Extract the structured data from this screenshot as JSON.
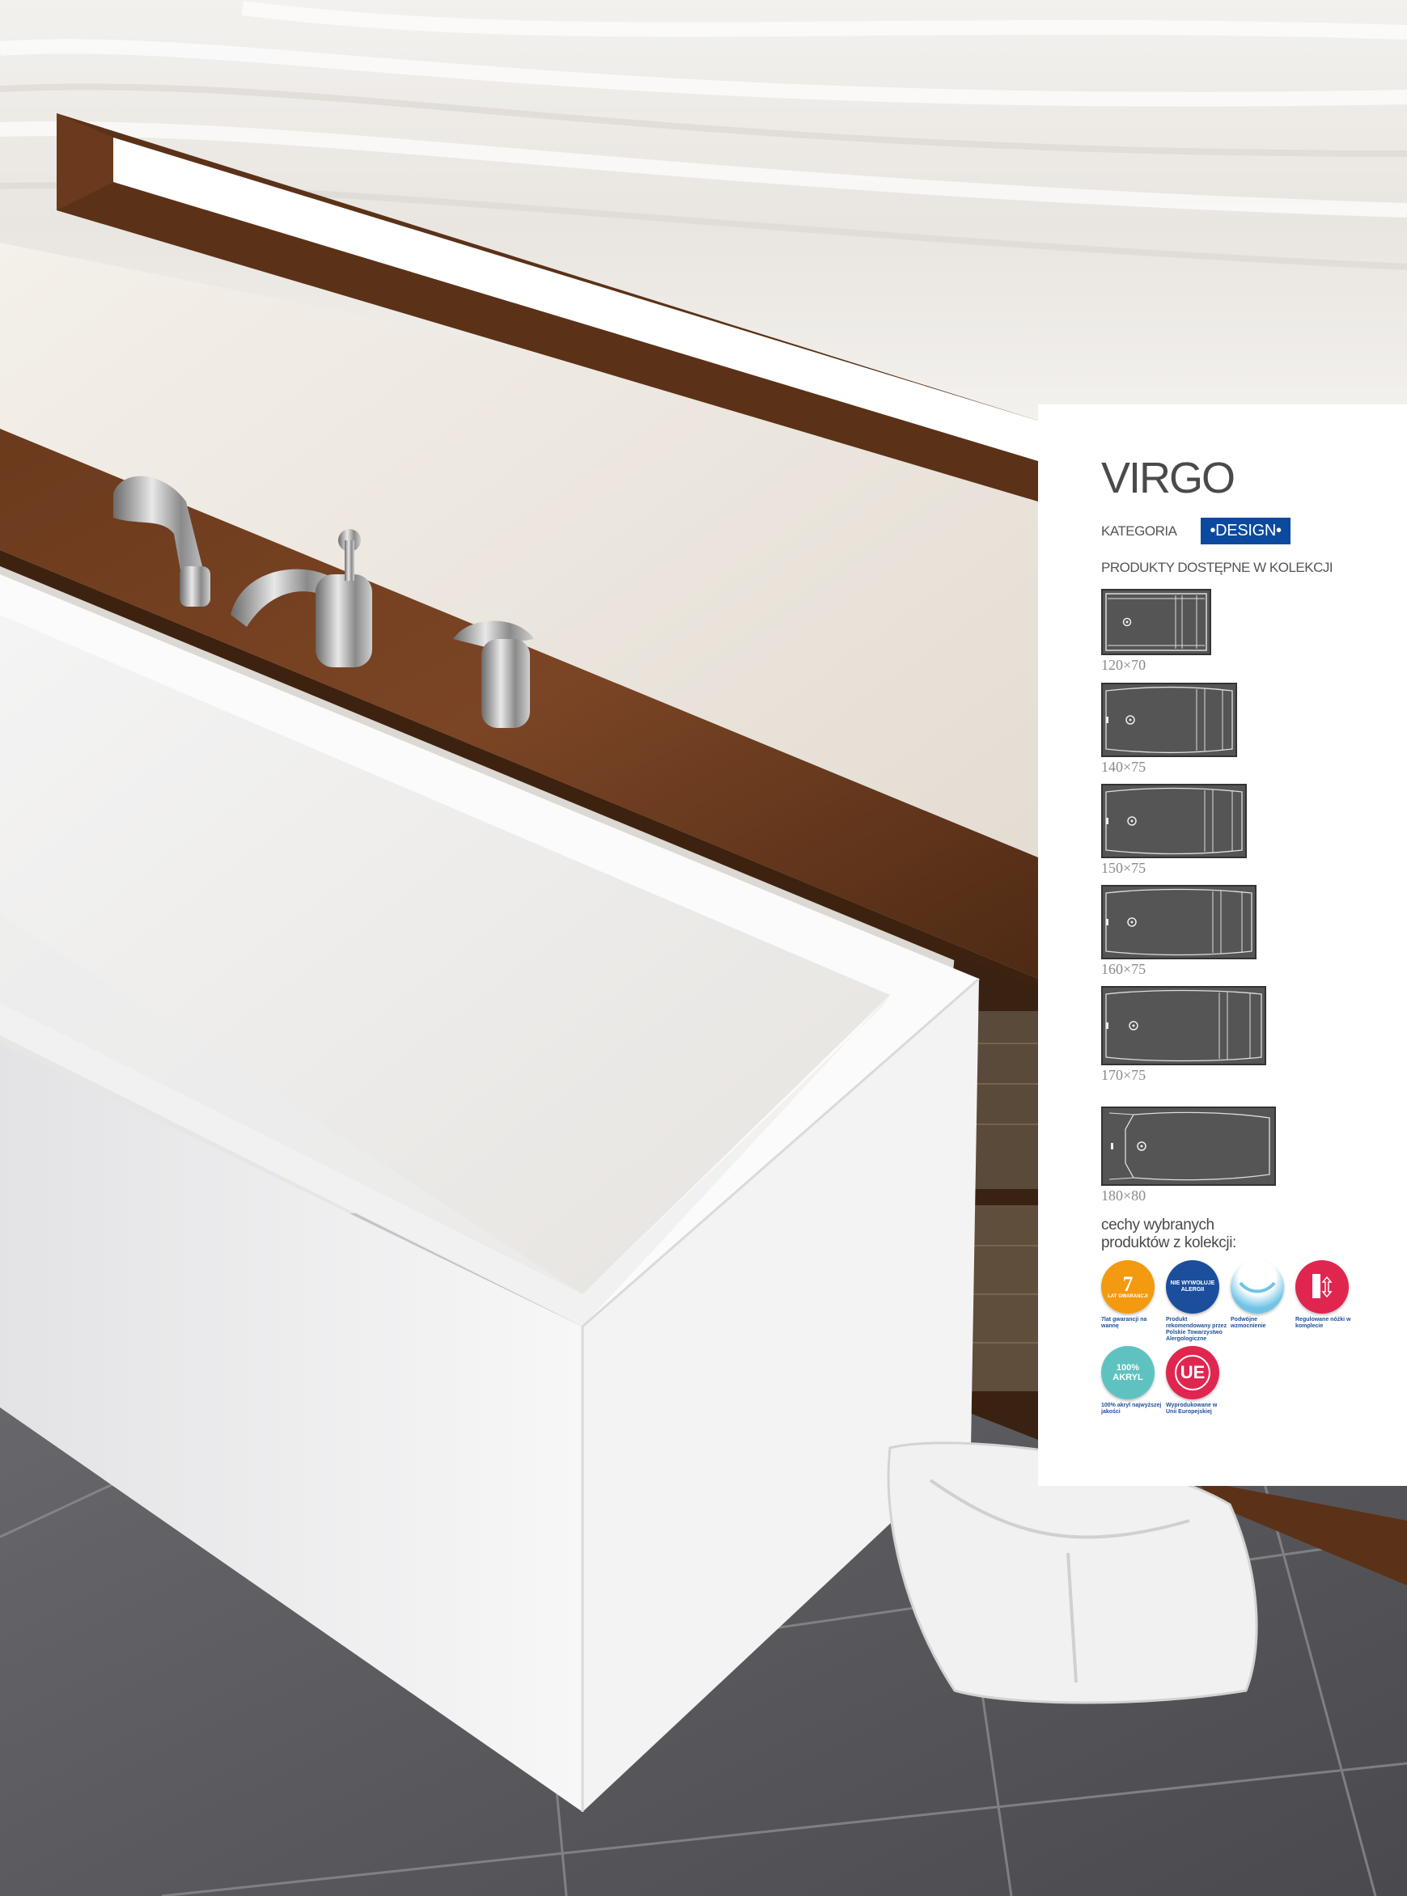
{
  "product": {
    "title": "VIRGO",
    "category_label": "KATEGORIA",
    "category_badge": "•DESIGN•",
    "products_heading": "PRODUKTY DOSTĘPNE W KOLEKCJI"
  },
  "sizes": [
    "120×70",
    "140×75",
    "150×75",
    "160×75",
    "170×75",
    "180×80"
  ],
  "features": {
    "heading_line1": "cechy wybranych",
    "heading_line2": "produktów z kolekcji:",
    "items": [
      {
        "icon": "warranty-7-years-icon",
        "icon_text_1": "7",
        "icon_text_2": "LAT GWARANCJI",
        "caption": "7lat gwarancji na wannę",
        "color": "#f39a10"
      },
      {
        "icon": "hypoallergenic-icon",
        "icon_text_1": "NIE WYWOŁUJE",
        "icon_text_2": "ALERGII",
        "caption": "Produkt rekomendowany przez Polskie Towarzystwo Alergologiczne",
        "color": "#1b4f9e"
      },
      {
        "icon": "double-reinforcement-icon",
        "icon_text_1": "",
        "icon_text_2": "",
        "caption": "Podwójne wzmocnienie",
        "color": "#6fc3e6"
      },
      {
        "icon": "adjustable-legs-icon",
        "icon_text_1": "",
        "icon_text_2": "",
        "caption": "Regulowane nóżki w komplecie",
        "color": "#e0264f"
      },
      {
        "icon": "acrylic-100-icon",
        "icon_text_1": "100%",
        "icon_text_2": "AKRYL",
        "caption": "100% akryl najwyższej jakości",
        "color": "#5ec3c0"
      },
      {
        "icon": "made-in-eu-icon",
        "icon_text_1": "UE",
        "icon_text_2": "",
        "caption": "Wyprodukowane w Unii Europejskiej",
        "color": "#e0264f"
      }
    ]
  }
}
